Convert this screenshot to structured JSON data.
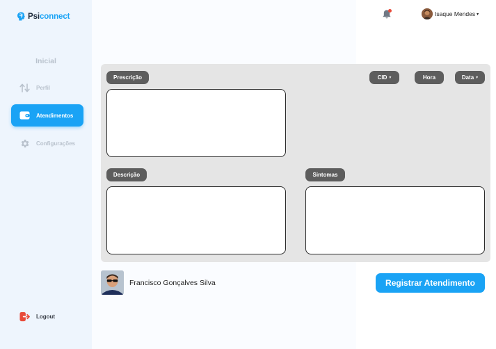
{
  "app": {
    "logo_part1": "Psi",
    "logo_part2": "connect",
    "brand_color": "#1aa3f5"
  },
  "sidebar": {
    "heading": "Inicial",
    "items": [
      {
        "label": "Perfil",
        "icon": "arrows-swap-icon",
        "active": false
      },
      {
        "label": "Atendimentos",
        "icon": "wallet-icon",
        "active": true
      },
      {
        "label": "Configurações",
        "icon": "gear-icon",
        "active": false
      }
    ],
    "logout": {
      "label": "Logout",
      "icon": "logout-icon",
      "color": "#e84b3a"
    }
  },
  "header": {
    "notification_icon": "bell-icon",
    "has_notification": true,
    "user_name": "Isaque Mendes",
    "user_caret": "▾"
  },
  "form": {
    "prescricao_label": "Prescrição",
    "cid_label": "CID",
    "hora_label": "Hora",
    "data_label": "Data",
    "descricao_label": "Descrição",
    "sintomas_label": "Sintomas",
    "caret": "▾",
    "prescricao_value": "",
    "descricao_value": "",
    "sintomas_value": ""
  },
  "patient": {
    "name": "Francisco Gonçalves Silva"
  },
  "actions": {
    "register_label": "Registrar Atendimento"
  }
}
